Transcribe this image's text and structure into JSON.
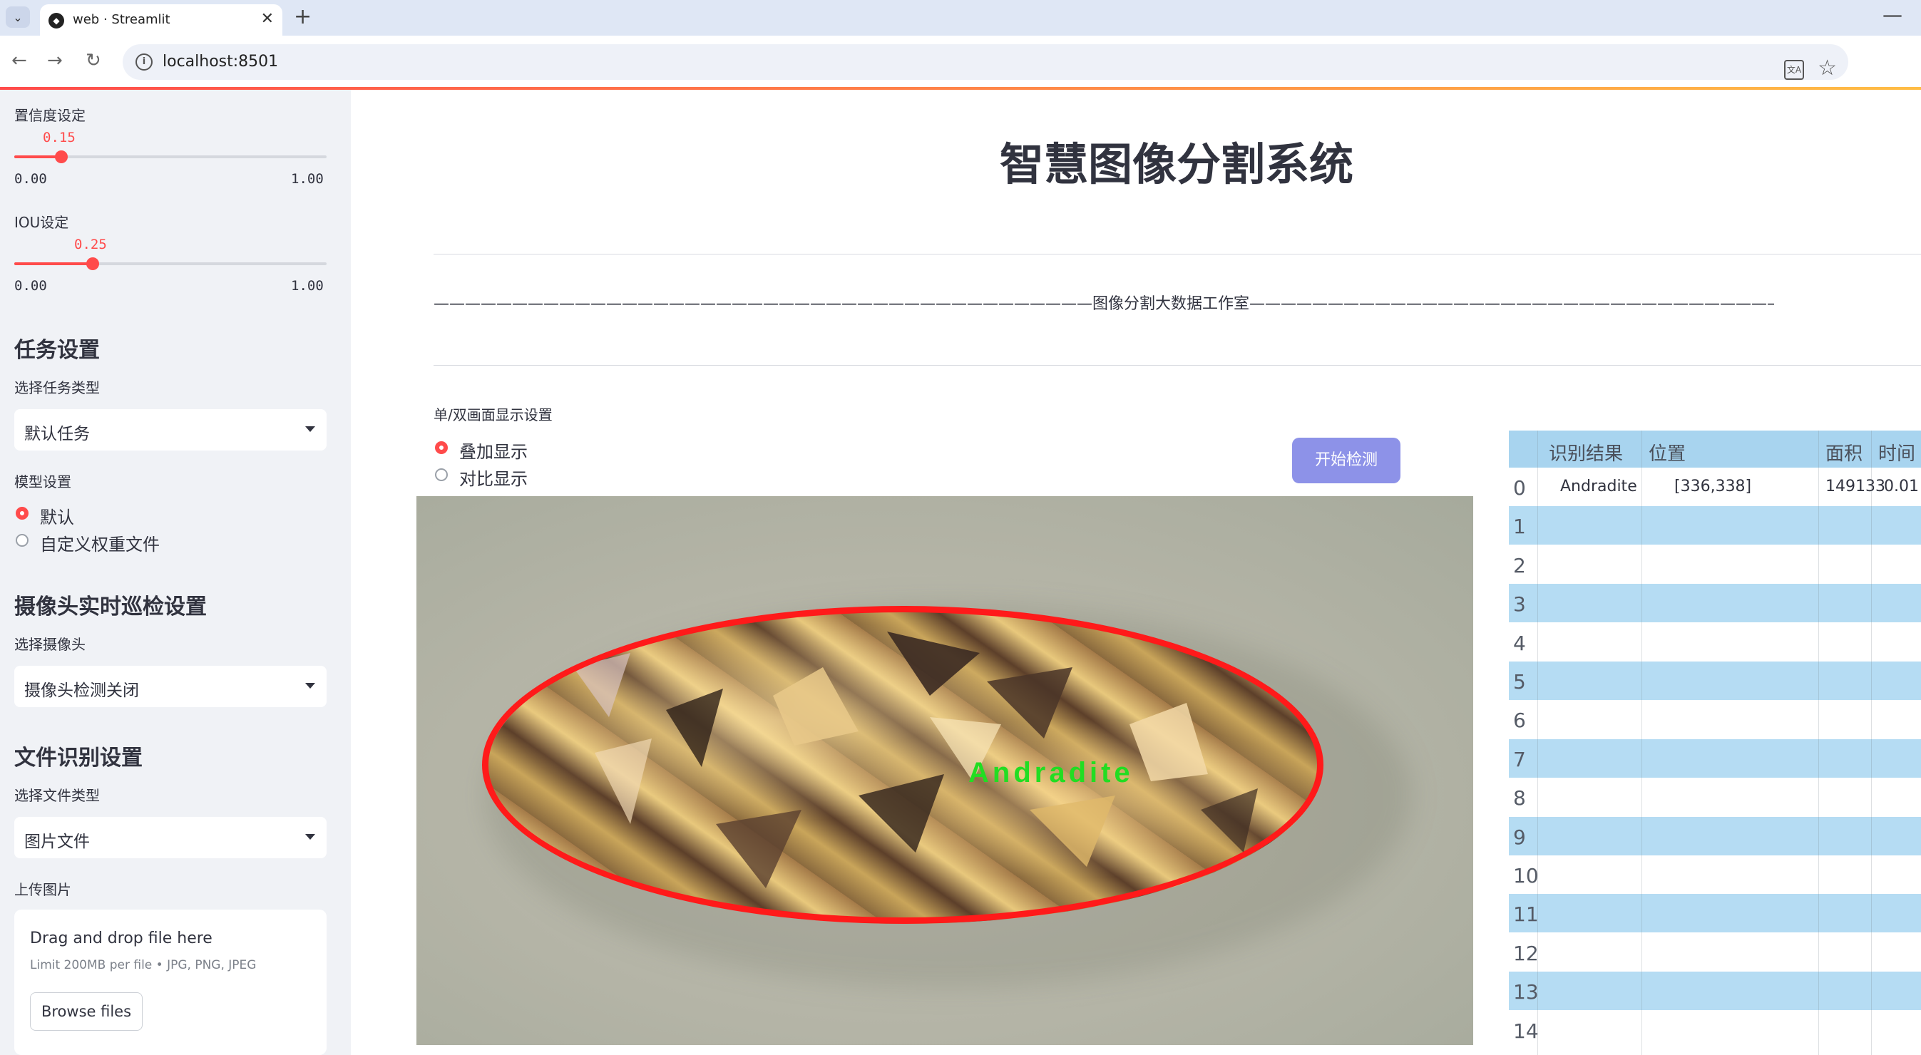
{
  "browser": {
    "tab_title": "web · Streamlit",
    "new_tab": "+",
    "close": "✕",
    "url": "localhost:8501",
    "minimize": "—"
  },
  "sidebar": {
    "confidence": {
      "label": "置信度设定",
      "value": "0.15",
      "min": "0.00",
      "max": "1.00",
      "fraction": 0.15
    },
    "iou": {
      "label": "IOU设定",
      "value": "0.25",
      "min": "0.00",
      "max": "1.00",
      "fraction": 0.25
    },
    "task": {
      "heading": "任务设置",
      "label": "选择任务类型",
      "selected": "默认任务"
    },
    "model": {
      "label": "模型设置",
      "options": [
        "默认",
        "自定义权重文件"
      ],
      "selected_index": 0
    },
    "camera": {
      "heading": "摄像头实时巡检设置",
      "label": "选择摄像头",
      "selected": "摄像头检测关闭"
    },
    "file": {
      "heading": "文件识别设置",
      "label": "选择文件类型",
      "selected": "图片文件"
    },
    "upload": {
      "label": "上传图片",
      "title": "Drag and drop file here",
      "limit": "Limit 200MB per file • JPG, PNG, JPEG",
      "button": "Browse files"
    }
  },
  "main": {
    "title": "智慧图像分割系统",
    "banner": "——————————————————————————————————————————图像分割大数据工作室——————————————————————————————————————————————",
    "display_mode": {
      "label": "单/双画面显示设置",
      "options": [
        "叠加显示",
        "对比显示"
      ],
      "selected_index": 0
    },
    "start_button": "开始检测",
    "detection_label": "Andradite"
  },
  "table": {
    "columns": [
      "识别结果",
      "位置",
      "面积",
      "时间"
    ],
    "rows": [
      {
        "index": "0",
        "result": "Andradite",
        "position": "[336,338]",
        "area": "149133",
        "time": "0.01"
      },
      {
        "index": "1"
      },
      {
        "index": "2"
      },
      {
        "index": "3"
      },
      {
        "index": "4"
      },
      {
        "index": "5"
      },
      {
        "index": "6"
      },
      {
        "index": "7"
      },
      {
        "index": "8"
      },
      {
        "index": "9"
      },
      {
        "index": "10"
      },
      {
        "index": "11"
      },
      {
        "index": "12"
      },
      {
        "index": "13"
      },
      {
        "index": "14"
      }
    ]
  },
  "colors": {
    "accent": "#ff4b4b",
    "button": "#8d92e8",
    "table_header": "#a8d4ef",
    "detection_box": "#ff1a1a",
    "detection_text": "#22dd22"
  }
}
